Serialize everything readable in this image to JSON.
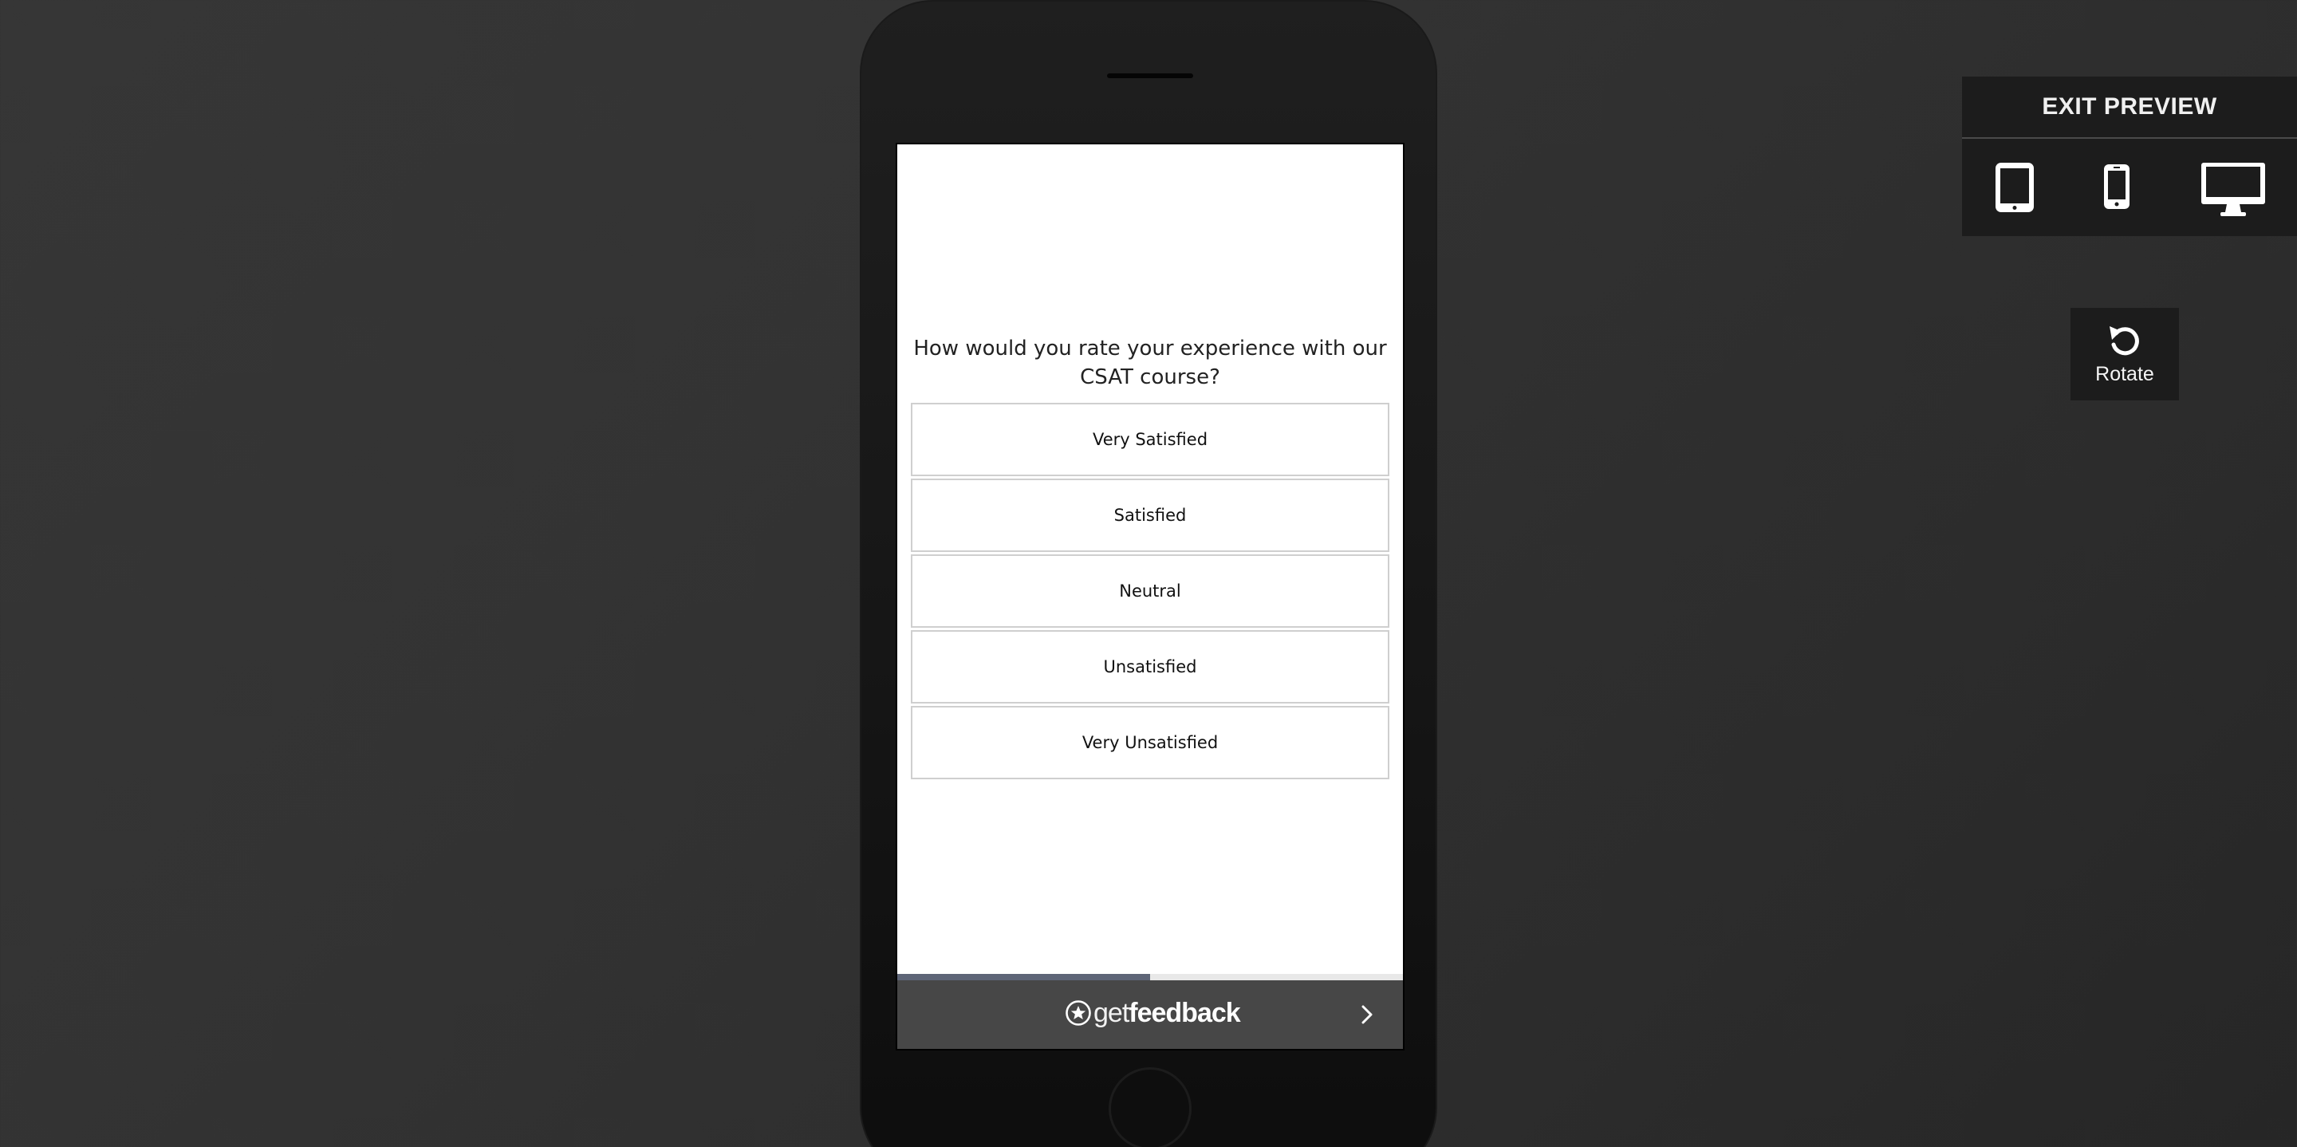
{
  "survey": {
    "question": "How would you rate your experience with our CSAT course?",
    "options": [
      "Very Satisfied",
      "Satisfied",
      "Neutral",
      "Unsatisfied",
      "Very Unsatisfied"
    ],
    "progress_percent": 50
  },
  "footer": {
    "brand_light": "get",
    "brand_bold": "feedback",
    "next_icon": "chevron-right-icon"
  },
  "preview": {
    "exit_label": "EXIT PREVIEW",
    "devices": [
      "tablet-icon",
      "phone-icon",
      "desktop-icon"
    ]
  },
  "rotate": {
    "label": "Rotate",
    "icon": "rotate-icon"
  },
  "colors": {
    "background": "#333333",
    "phone_body": "#151515",
    "footer_bar": "#474747",
    "progress_fill": "#5e6577",
    "panel": "#1c1c1c"
  }
}
